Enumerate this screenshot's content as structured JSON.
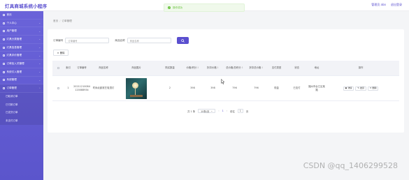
{
  "app": {
    "title": "灯具商城系统小程序",
    "user_label": "管理员 abo",
    "logout_label": "退出登录"
  },
  "toast": {
    "message": "操作成功"
  },
  "sidebar": {
    "items": [
      {
        "label": "首页",
        "icon": "home-icon"
      },
      {
        "label": "个人中心",
        "icon": "user-icon"
      },
      {
        "label": "用户管理",
        "icon": "users-icon"
      },
      {
        "label": "灯具分类管理",
        "icon": "list-icon"
      },
      {
        "label": "灯具信息管理",
        "icon": "lamp-icon"
      },
      {
        "label": "灯具评价管理",
        "icon": "comment-icon"
      },
      {
        "label": "订单加入关管理",
        "icon": "cart-icon"
      },
      {
        "label": "系统引入管理",
        "icon": "grid-icon"
      },
      {
        "label": "系统管理",
        "icon": "gear-icon"
      },
      {
        "label": "订单管理",
        "icon": "order-icon"
      }
    ],
    "sub_items": [
      {
        "label": "已取消订单"
      },
      {
        "label": "已付款订单"
      },
      {
        "label": "已发货订单"
      },
      {
        "label": "未支付订单"
      }
    ]
  },
  "breadcrumb": {
    "home": "首页",
    "current": "订单管理"
  },
  "search": {
    "order_no_label": "订单编号",
    "order_no_placeholder": "订单编号",
    "product_name_label": "商品名称",
    "product_name_placeholder": "商品名称"
  },
  "toolbar": {
    "delete_label": "删除"
  },
  "table": {
    "headers": [
      "索引",
      "订单编号",
      "商品名称",
      "商品图片",
      "购买数量",
      "价格/积分",
      "折扣价格",
      "总价格/总积分",
      "折扣总价格",
      "支付类型",
      "状态",
      "地址",
      "操作"
    ],
    "rows": [
      {
        "index": "1",
        "order_no": "20211210084 120088934",
        "product_name": "时尚北欧铁艺吸顶灯",
        "quantity": "2",
        "price": "398",
        "discount_price": "398",
        "total": "796",
        "discount_total": "796",
        "pay_type": "现金",
        "status": "已支付",
        "address": "福州市台江区某路"
      }
    ],
    "actions": {
      "detail": "详情",
      "ship": "发货",
      "delete": "删除"
    }
  },
  "pager": {
    "total": "共 1 条",
    "page_size": "10条/页",
    "current_page": "1",
    "goto_label": "前往",
    "goto_value": "1",
    "page_suffix": "页"
  },
  "watermark": "CSDN @qq_1406299528",
  "colors": {
    "accent": "#5a4fcf",
    "sidebar": "#6a63d9",
    "success": "#67c23a"
  }
}
